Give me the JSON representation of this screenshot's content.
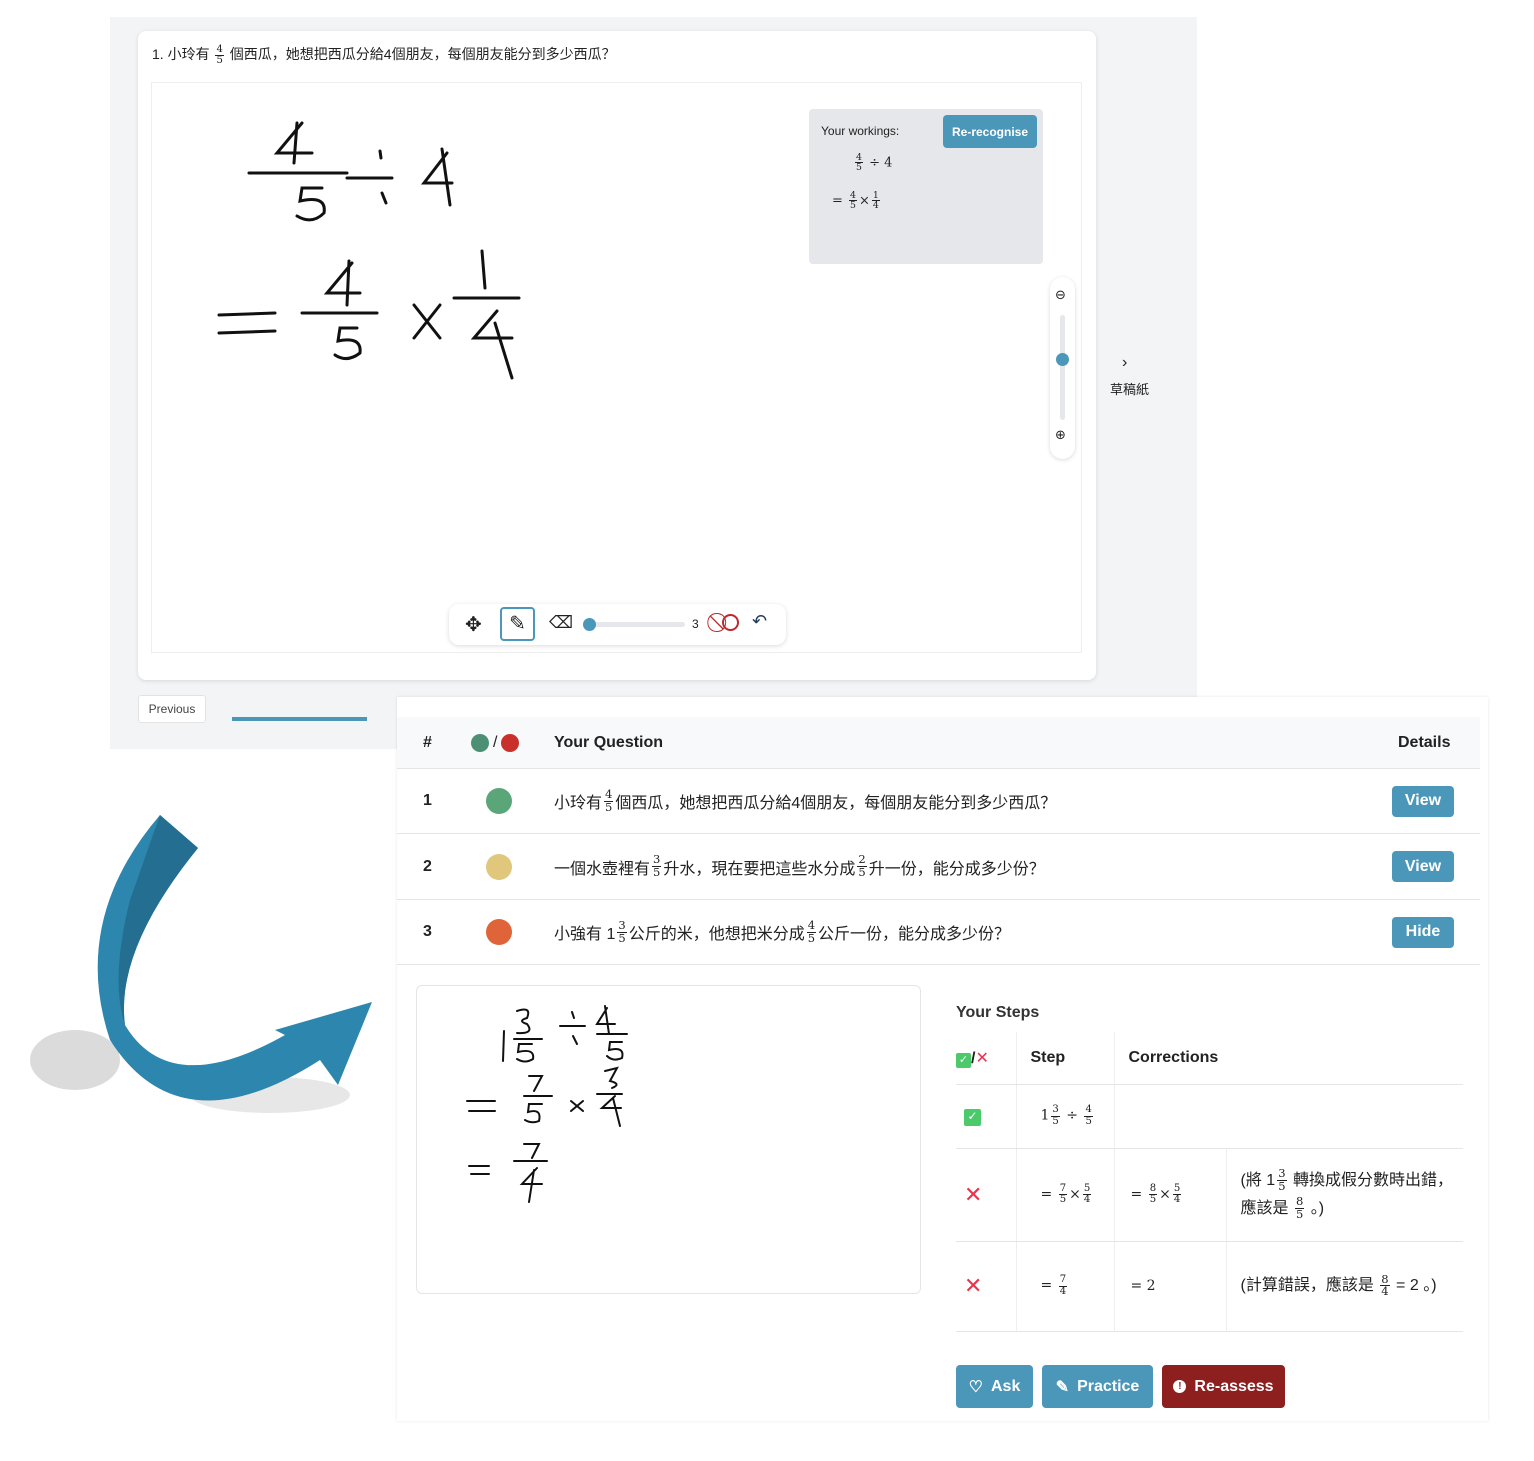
{
  "question_panel": {
    "title": [
      "1. 小玲有 ",
      {
        "n": "4",
        "d": "5"
      },
      " 個西瓜，她想把西瓜分給4個朋友，每個朋友能分到多少西瓜？"
    ],
    "workings_label": "Your workings:",
    "rerecognise_label": "Re-recognise",
    "workings": [
      [
        {
          "n": "4",
          "d": "5"
        },
        " ÷ 4"
      ],
      [
        "= ",
        {
          "n": "4",
          "d": "5"
        },
        "×",
        {
          "n": "1",
          "d": "4"
        }
      ]
    ],
    "side_label": "草稿紙",
    "brush_size": "3",
    "zoom_level": 0.35,
    "previous_label": "Previous"
  },
  "results": {
    "headers": {
      "num": "#",
      "slash": "/",
      "question": "Your Question",
      "details": "Details"
    },
    "questions": [
      {
        "num": "1",
        "face": "happy",
        "face_color": "#5aa678",
        "text": [
          "小玲有 ",
          {
            "n": "4",
            "d": "5"
          },
          " 個西瓜，她想把西瓜分給4個朋友，每個朋友能分到多少西瓜？"
        ],
        "action": "View"
      },
      {
        "num": "2",
        "face": "neutral",
        "face_color": "#e0c77c",
        "text": [
          "一個水壺裡有 ",
          {
            "n": "3",
            "d": "5"
          },
          " 升水，現在要把這些水分成 ",
          {
            "n": "2",
            "d": "5"
          },
          " 升一份，能分成多少份？"
        ],
        "action": "View"
      },
      {
        "num": "3",
        "face": "unhappy",
        "face_color": "#e0643a",
        "text": [
          "小強有 1",
          {
            "n": "3",
            "d": "5"
          },
          " 公斤的米，他想把米分成 ",
          {
            "n": "4",
            "d": "5"
          },
          " 公斤一份，能分成多少份？"
        ],
        "action": "Hide"
      }
    ],
    "steps_title": "Your Steps",
    "steps_headers": {
      "check": "/",
      "step": "Step",
      "corrections": "Corrections"
    },
    "steps": [
      {
        "ok": true,
        "step": [
          "1",
          {
            "n": "3",
            "d": "5"
          },
          " ÷ ",
          {
            "n": "4",
            "d": "5"
          }
        ],
        "correction": [],
        "note": []
      },
      {
        "ok": false,
        "step": [
          "= ",
          {
            "n": "7",
            "d": "5"
          },
          "×",
          {
            "n": "5",
            "d": "4"
          }
        ],
        "correction": [
          "= ",
          {
            "n": "8",
            "d": "5"
          },
          "×",
          {
            "n": "5",
            "d": "4"
          }
        ],
        "note": [
          "(將 1",
          {
            "n": "3",
            "d": "5"
          },
          " 轉換成假分數時出錯，應該是 ",
          {
            "n": "8",
            "d": "5"
          },
          " 。)"
        ]
      },
      {
        "ok": false,
        "step": [
          "= ",
          {
            "n": "7",
            "d": "4"
          }
        ],
        "correction": [
          "= 2"
        ],
        "note": [
          "(計算錯誤，應該是 ",
          {
            "n": "8",
            "d": "4"
          },
          " = 2 。)"
        ]
      }
    ],
    "buttons": {
      "ask": "Ask",
      "practice": "Practice",
      "reassess": "Re-assess"
    }
  },
  "colors": {
    "primary": "#4a97ba",
    "danger": "#8e1f1f",
    "ok": "#4cc96b",
    "wrong": "#e8344e"
  }
}
